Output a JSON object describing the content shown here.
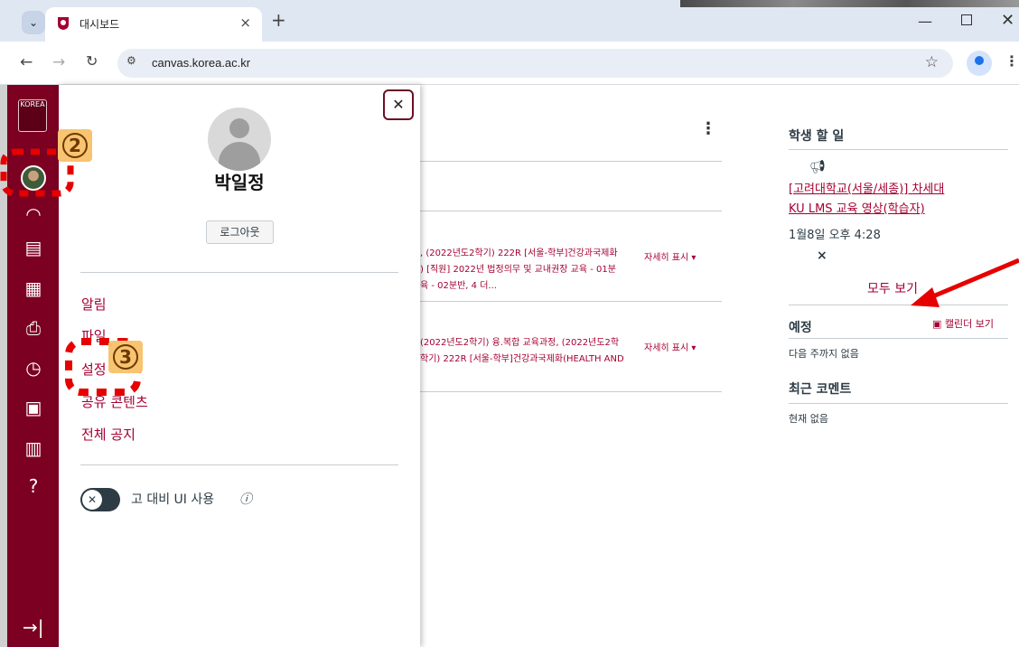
{
  "browser": {
    "tab_title": "대시보드",
    "url": "canvas.korea.ac.kr",
    "new_tab_icon": "+",
    "tab_close_icon": "×"
  },
  "sidebar": {
    "logo_text": "KOREA",
    "icons": [
      "dashboard-icon",
      "courses-icon",
      "calendar-icon",
      "inbox-icon",
      "history-icon",
      "commons-icon",
      "studio-icon",
      "help-icon",
      "collapse-icon"
    ]
  },
  "tray": {
    "name": "박일정",
    "logout": "로그아웃",
    "links": [
      "알림",
      "파일",
      "설정",
      "공유 콘텐츠",
      "전체 공지"
    ],
    "toggle_label": "고 대비 UI 사용",
    "info_icon": "ⓘ"
  },
  "stream": {
    "item1_lines": [
      ", (2022년도2학기) 222R [서울-학부]건강과국제화",
      ") [직원] 2022년 법정의무 및 교내권장 교육 - 01분",
      "육 - 02분반, 4 더..."
    ],
    "item2_lines": [
      "(2022년도2학기) 융.복합 교육과정, (2022년도2학",
      "학기) 222R [서울-학부]건강과국제화(HEALTH AND"
    ],
    "show_more": "자세히 표시 ▾"
  },
  "right": {
    "todo_heading": "학생 할 일",
    "todo_link_lines": [
      "[고려대학교(서울/세종)] 차세대",
      "KU LMS 교육 영상(학습자)"
    ],
    "todo_date": "1월8일 오후 4:28",
    "dismiss": "×",
    "see_all": "모두 보기",
    "upcoming_heading": "예정",
    "calendar_link": "캘린더 보기",
    "upcoming_text": "다음 주까지 없음",
    "recent_heading": "최근 코멘트",
    "recent_text": "현재 없음"
  },
  "annotations": {
    "badge_2": "2",
    "badge_3": "3",
    "highlight_color": "#e60000",
    "badge_color": "#f8c471"
  }
}
